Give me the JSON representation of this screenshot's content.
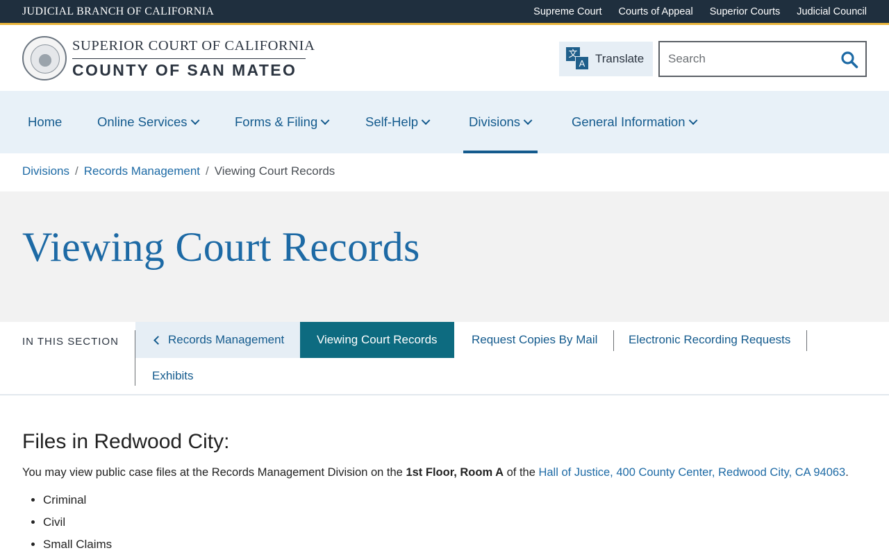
{
  "utility": {
    "branch": "JUDICIAL BRANCH OF CALIFORNIA",
    "links": [
      "Supreme Court",
      "Courts of Appeal",
      "Superior Courts",
      "Judicial Council"
    ]
  },
  "header": {
    "court_line1": "SUPERIOR COURT OF CALIFORNIA",
    "court_line2": "COUNTY OF SAN MATEO",
    "translate_label": "Translate",
    "search_placeholder": "Search"
  },
  "nav": {
    "items": [
      "Home",
      "Online Services",
      "Forms & Filing",
      "Self-Help",
      "Divisions",
      "General Information"
    ],
    "active": "Divisions"
  },
  "breadcrumb": {
    "items": [
      "Divisions",
      "Records Management"
    ],
    "current": "Viewing Court Records"
  },
  "hero": {
    "title": "Viewing Court Records"
  },
  "section_nav": {
    "heading": "IN THIS SECTION",
    "back": "Records Management",
    "items": [
      "Viewing Court Records",
      "Request Copies By Mail",
      "Electronic Recording Requests",
      "Exhibits"
    ],
    "active": "Viewing Court Records"
  },
  "content": {
    "heading": "Files in Redwood City:",
    "para_before": "You may view public case files at the Records Management Division on the ",
    "para_bold": "1st Floor, Room A",
    "para_mid": " of the ",
    "para_link": "Hall of Justice, 400 County Center, Redwood City, CA 94063",
    "para_end": ".",
    "list": [
      "Criminal",
      "Civil",
      "Small Claims"
    ]
  },
  "colors": {
    "utility_bg": "#1f2f3e",
    "accent_gold": "#e8b43a",
    "brand_blue": "#135a8d",
    "active_teal": "#0d6b80",
    "nav_bg": "#e8f1f8"
  },
  "icons": [
    "translate-icon",
    "search-icon",
    "chevron-down-icon",
    "chevron-left-icon"
  ]
}
